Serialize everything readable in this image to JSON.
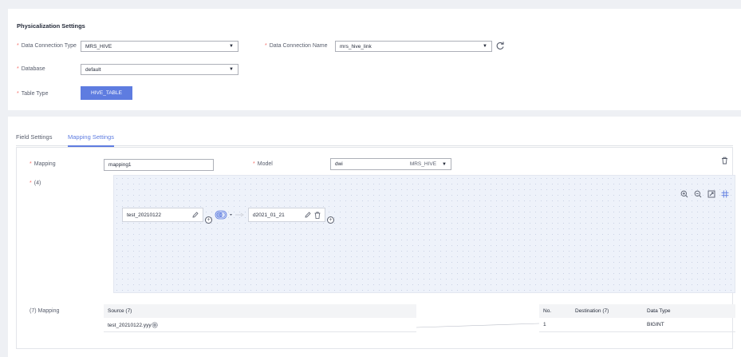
{
  "physicalization": {
    "title": "Physicalization Settings",
    "conn_type_label": "Data Connection Type",
    "conn_type_value": "MRS_HIVE",
    "conn_name_label": "Data Connection Name",
    "conn_name_value": "mrs_hive_link",
    "database_label": "Database",
    "database_value": "default",
    "table_type_label": "Table Type",
    "table_type_value": "HIVE_TABLE",
    "required_mark": "*"
  },
  "tabs": [
    {
      "label": "Field Settings"
    },
    {
      "label": "Mapping Settings"
    }
  ],
  "mapping": {
    "mapping_label": "Mapping",
    "mapping_value": "mapping1",
    "model_label": "Model",
    "model_value": "dwi",
    "model_tag": "MRS_HIVE",
    "count_label": "(4)",
    "source_node": "test_20210122",
    "target_node": "d2021_01_21"
  },
  "mapping_table": {
    "row_label": "(7) Mapping",
    "source_header": "Source (7)",
    "source_value": "test_20210122.yyy",
    "no_header": "No.",
    "dest_header": "Destination (7)",
    "type_header": "Data Type",
    "no_value": "1",
    "type_value": "BIGINT"
  },
  "colors": {
    "primary": "#5e7ce0",
    "required": "#f66f6a"
  }
}
